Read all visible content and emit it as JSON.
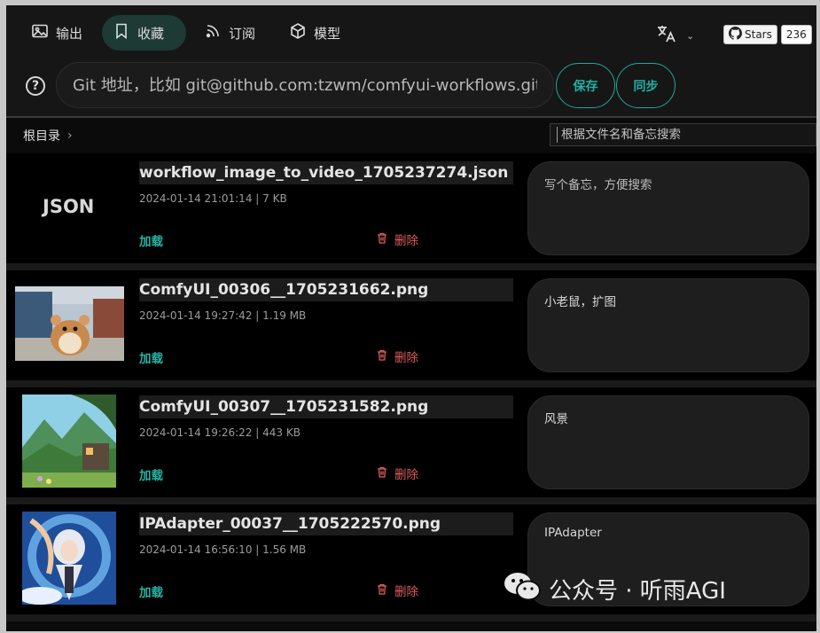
{
  "nav": {
    "tabs": [
      {
        "label": "输出",
        "icon": "image-icon",
        "active": false
      },
      {
        "label": "收藏",
        "icon": "bookmark-icon",
        "active": true
      },
      {
        "label": "订阅",
        "icon": "rss-icon",
        "active": false
      },
      {
        "label": "模型",
        "icon": "cube-icon",
        "active": false
      }
    ],
    "language_icon": "translate-icon",
    "github": {
      "stars_label": "Stars",
      "stars_count": "236",
      "icon": "github-icon"
    }
  },
  "git": {
    "placeholder": "Git 地址，比如 git@github.com:tzwm/comfyui-workflows.git",
    "save_label": "保存",
    "sync_label": "同步"
  },
  "breadcrumb": {
    "root": "根目录"
  },
  "search": {
    "placeholder": "根据文件名和备忘搜索"
  },
  "files": [
    {
      "name": "workflow_image_to_video_1705237274.json",
      "thumb_text": "JSON",
      "meta": "2024-01-14 21:01:14 | 7 KB",
      "load_label": "加载",
      "delete_label": "删除",
      "note": "",
      "note_placeholder": "写个备忘，方便搜索"
    },
    {
      "name": "ComfyUI_00306__1705231662.png",
      "meta": "2024-01-14 19:27:42 | 1.19 MB",
      "load_label": "加载",
      "delete_label": "删除",
      "note": "小老鼠，扩图"
    },
    {
      "name": "ComfyUI_00307__1705231582.png",
      "meta": "2024-01-14 19:26:22 | 443 KB",
      "load_label": "加载",
      "delete_label": "删除",
      "note": "风景"
    },
    {
      "name": "IPAdapter_00037__1705222570.png",
      "meta": "2024-01-14 16:56:10 | 1.56 MB",
      "load_label": "加载",
      "delete_label": "删除",
      "note": "IPAdapter"
    }
  ],
  "watermark": {
    "text": "公众号 · 听雨AGI"
  },
  "colors": {
    "accent": "#20b2a4",
    "danger": "#e05d5d",
    "active_tab_bg": "#1d3a34"
  }
}
